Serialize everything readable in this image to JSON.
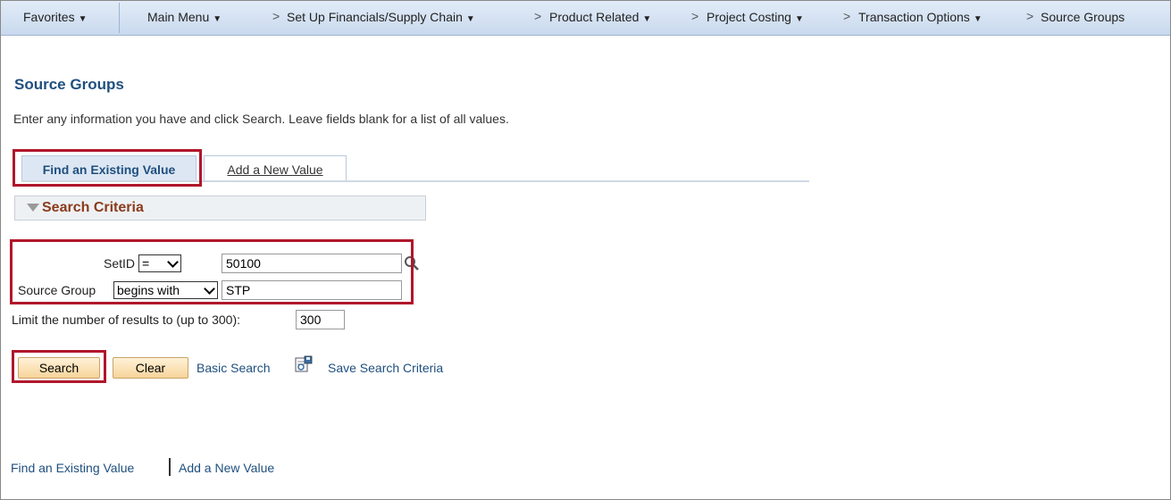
{
  "navbar": {
    "favorites": "Favorites",
    "main_menu": "Main Menu",
    "breadcrumbs": [
      "Set Up Financials/Supply Chain",
      "Product Related",
      "Project Costing",
      "Transaction Options",
      "Source Groups"
    ],
    "separator": ">"
  },
  "page": {
    "title": "Source Groups",
    "instructions": "Enter any information you have and click Search. Leave fields blank for a list of all values."
  },
  "tabs": {
    "active": "Find an Existing Value",
    "inactive": "Add a New Value"
  },
  "search_criteria": {
    "header": "Search Criteria",
    "setid": {
      "label": "SetID",
      "operator": "=",
      "value": "50100"
    },
    "source_group": {
      "label": "Source Group",
      "operator": "begins with",
      "value": "STP"
    },
    "limit": {
      "label": "Limit the number of results to (up to 300):",
      "value": "300"
    }
  },
  "actions": {
    "search": "Search",
    "clear": "Clear",
    "basic_search": "Basic Search",
    "save_search_criteria": "Save Search Criteria"
  },
  "footer": {
    "find_existing": "Find an Existing Value",
    "add_new": "Add a New Value"
  },
  "colors": {
    "highlight": "#b0162b",
    "link": "#1f4f7f",
    "section_title": "#8a3b1b"
  }
}
